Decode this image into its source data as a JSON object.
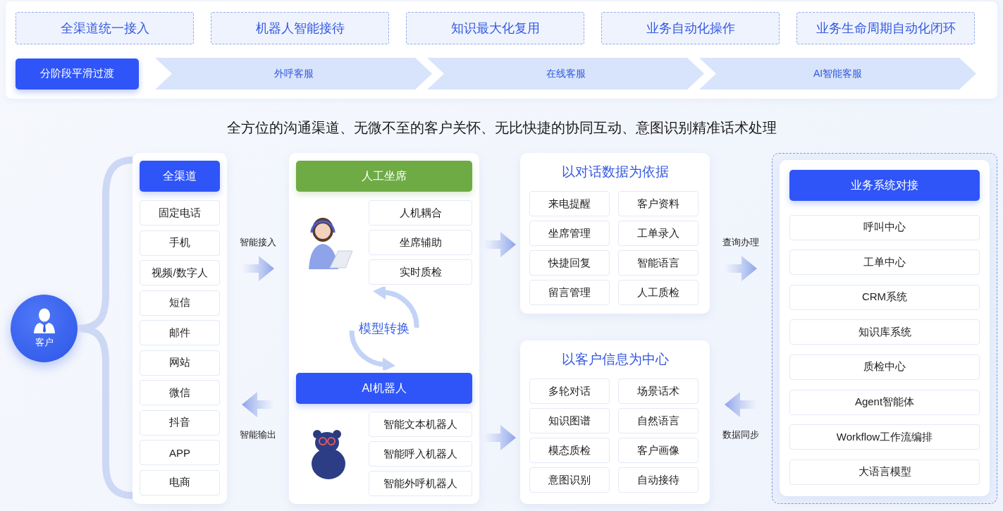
{
  "features": [
    "全渠道统一接入",
    "机器人智能接待",
    "知识最大化复用",
    "业务自动化操作",
    "业务生命周期自动化闭环"
  ],
  "stage_label": "分阶段平滑过渡",
  "phases": [
    "外呼客服",
    "在线客服",
    "AI智能客服"
  ],
  "headline": "全方位的沟通渠道、无微不至的客户关怀、无比快捷的协同互动、意图识别精准话术处理",
  "customer": "客户",
  "channels": {
    "title": "全渠道",
    "items": [
      "固定电话",
      "手机",
      "视频/数字人",
      "短信",
      "邮件",
      "网站",
      "微信",
      "抖音",
      "APP",
      "电商"
    ]
  },
  "in_label": "智能接入",
  "out_label": "智能输出",
  "agent": {
    "title": "人工坐席",
    "items": [
      "人机耦合",
      "坐席辅助",
      "实时质检"
    ]
  },
  "switch_label": "模型转换",
  "robot": {
    "title": "AI机器人",
    "items": [
      "智能文本机器人",
      "智能呼入机器人",
      "智能外呼机器人"
    ]
  },
  "dialog_panel": {
    "title": "以对话数据为依据",
    "items": [
      "来电提醒",
      "客户资料",
      "坐席管理",
      "工单录入",
      "快捷回复",
      "智能语言",
      "留言管理",
      "人工质检"
    ]
  },
  "customer_panel": {
    "title": "以客户信息为中心",
    "items": [
      "多轮对话",
      "场景话术",
      "知识图谱",
      "自然语言",
      "模态质检",
      "客户画像",
      "意图识别",
      "自动接待"
    ]
  },
  "query_label": "查询办理",
  "sync_label": "数据同步",
  "business": {
    "title": "业务系统对接",
    "items": [
      "呼叫中心",
      "工单中心",
      "CRM系统",
      "知识库系统",
      "质检中心",
      "Agent智能体",
      "Workflow工作流编排",
      "大语言模型"
    ]
  }
}
